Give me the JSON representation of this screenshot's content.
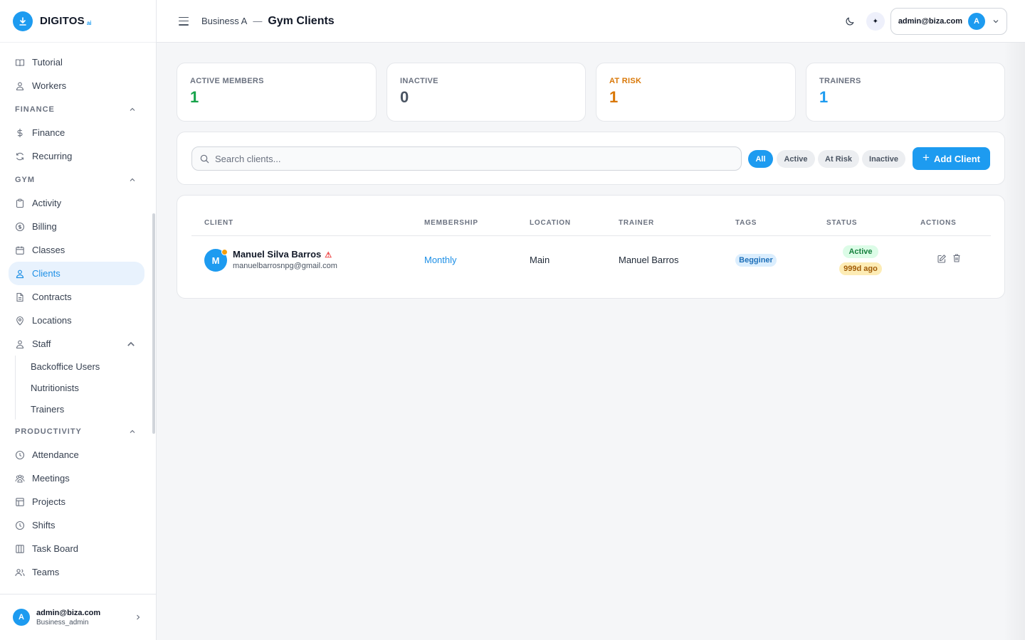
{
  "brand": {
    "name": "DIGITOS",
    "suffix": "ai"
  },
  "sidebar": {
    "top_items": [
      {
        "label": "Tutorial",
        "icon": "book-icon"
      },
      {
        "label": "Workers",
        "icon": "users-icon"
      }
    ],
    "finance": {
      "title": "FINANCE",
      "items": [
        {
          "label": "Finance",
          "icon": "dollar-icon"
        },
        {
          "label": "Recurring",
          "icon": "refresh-icon"
        }
      ]
    },
    "gym": {
      "title": "GYM",
      "items": [
        {
          "label": "Activity",
          "icon": "clipboard-icon"
        },
        {
          "label": "Billing",
          "icon": "coin-icon"
        },
        {
          "label": "Classes",
          "icon": "calendar-icon"
        },
        {
          "label": "Clients",
          "icon": "users-icon"
        },
        {
          "label": "Contracts",
          "icon": "file-icon"
        },
        {
          "label": "Locations",
          "icon": "map-pin-icon"
        },
        {
          "label": "Staff",
          "icon": "users-icon"
        }
      ]
    },
    "staff_sub": [
      "Backoffice Users",
      "Nutritionists",
      "Trainers"
    ],
    "productivity": {
      "title": "PRODUCTIVITY",
      "items": [
        {
          "label": "Attendance",
          "icon": "clock-icon"
        },
        {
          "label": "Meetings",
          "icon": "group-icon"
        },
        {
          "label": "Projects",
          "icon": "layout-icon"
        },
        {
          "label": "Shifts",
          "icon": "clock-icon"
        },
        {
          "label": "Task Board",
          "icon": "columns-icon"
        },
        {
          "label": "Teams",
          "icon": "users-icon"
        }
      ]
    },
    "footer": {
      "email": "admin@biza.com",
      "role": "Business_admin",
      "avatar": "A"
    }
  },
  "topbar": {
    "breadcrumb": "Business A",
    "separator": "—",
    "title": "Gym Clients",
    "spark": "✦",
    "user_email": "admin@biza.com",
    "avatar": "A"
  },
  "stats": [
    {
      "label": "ACTIVE MEMBERS",
      "value": "1",
      "color": "#16a34a"
    },
    {
      "label": "INACTIVE",
      "value": "0",
      "color": "#4b5563"
    },
    {
      "label": "AT RISK",
      "value": "1",
      "color": "#d97706"
    },
    {
      "label": "TRAINERS",
      "value": "1",
      "color": "#1d9bf0"
    }
  ],
  "filters": {
    "search_placeholder": "Search clients...",
    "chips": [
      "All",
      "Active",
      "At Risk",
      "Inactive"
    ],
    "selected": "All",
    "add_label": "Add Client"
  },
  "table": {
    "headers": [
      "CLIENT",
      "MEMBERSHIP",
      "LOCATION",
      "TRAINER",
      "TAGS",
      "STATUS",
      "ACTIONS"
    ],
    "rows": [
      {
        "avatar": "M",
        "name": "Manuel Silva Barros",
        "warning": "⚠",
        "email": "manuelbarrosnpg@gmail.com",
        "membership": "Monthly",
        "location": "Main",
        "trainer": "Manuel Barros",
        "tag": "Begginer",
        "status": "Active",
        "last_seen": "999d ago"
      }
    ]
  },
  "colors": {
    "accent": "#1d9bf0",
    "warning": "#f59e0b",
    "success": "#16a34a"
  }
}
